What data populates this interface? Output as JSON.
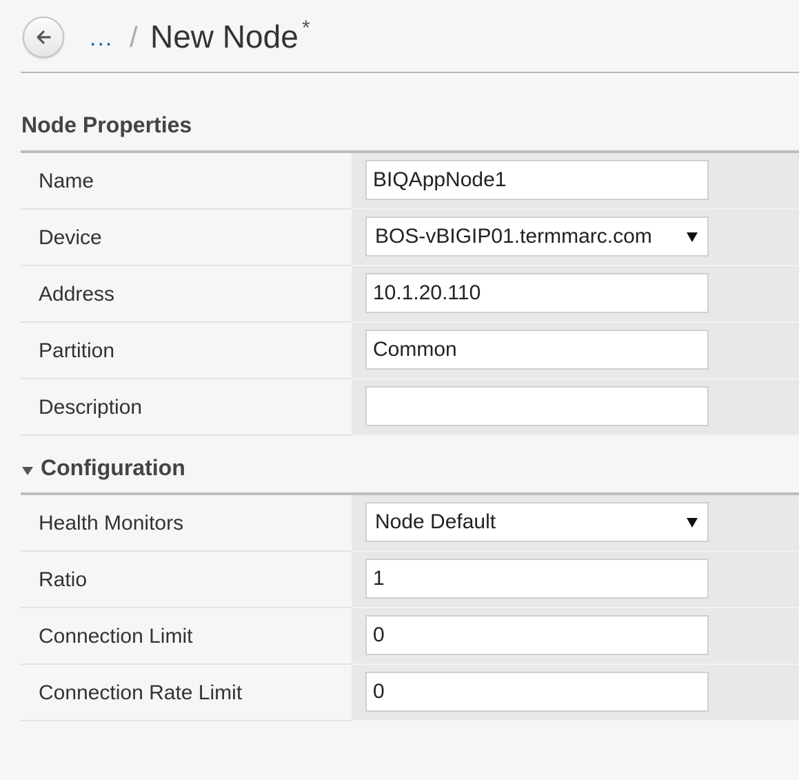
{
  "header": {
    "breadcrumb_ellipsis": "...",
    "separator": "/",
    "title": "New Node",
    "dirty_marker": "*"
  },
  "node_properties": {
    "title": "Node Properties",
    "fields": {
      "name": {
        "label": "Name",
        "value": "BIQAppNode1"
      },
      "device": {
        "label": "Device",
        "value": "BOS-vBIGIP01.termmarc.com"
      },
      "address": {
        "label": "Address",
        "value": "10.1.20.110"
      },
      "partition": {
        "label": "Partition",
        "value": "Common"
      },
      "description": {
        "label": "Description",
        "value": ""
      }
    }
  },
  "configuration": {
    "title": "Configuration",
    "fields": {
      "health_monitors": {
        "label": "Health Monitors",
        "value": "Node Default"
      },
      "ratio": {
        "label": "Ratio",
        "value": "1"
      },
      "connection_limit": {
        "label": "Connection Limit",
        "value": "0"
      },
      "connection_rate_limit": {
        "label": "Connection Rate Limit",
        "value": "0"
      }
    }
  },
  "icons": {
    "back": "back-arrow-icon",
    "collapse": "caret-down-icon",
    "dropdown": "dropdown-triangle-icon"
  },
  "colors": {
    "breadcrumb_link": "#1a64a6",
    "value_column_bg": "#e8e8e8",
    "page_bg": "#f6f6f6"
  }
}
